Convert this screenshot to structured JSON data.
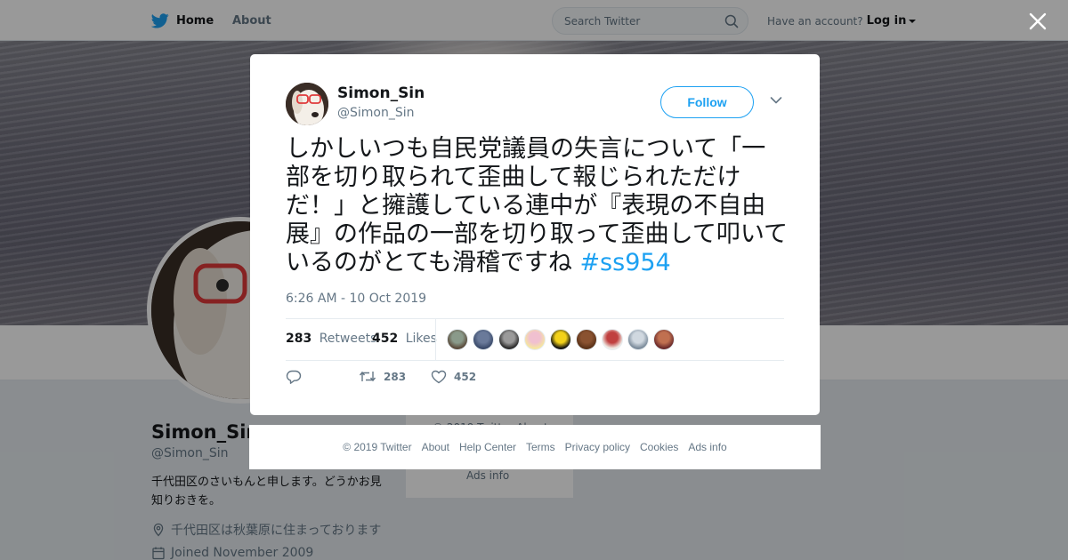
{
  "nav": {
    "home_label": "Home",
    "about_label": "About",
    "search_placeholder": "Search Twitter",
    "account_prompt": "Have an account?",
    "login_label": "Log in"
  },
  "profile": {
    "name": "Simon_Sin",
    "handle": "@Simon_Sin",
    "bio": "千代田区のさいもんと申します。どうかお見知りおきを。",
    "location": "千代田区は秋葉原に住まっております",
    "joined": "Joined November 2009"
  },
  "side_footer": {
    "copyright_partial": "© 2019 Twitter  About",
    "ads_info": "Ads info"
  },
  "tweet": {
    "author_name": "Simon_Sin",
    "author_handle": "@Simon_Sin",
    "follow_label": "Follow",
    "text": "しかしいつも自民党議員の失言について「一部を切り取られて歪曲して報じられただけだ！」と擁護している連中が『表現の不自由展』の作品の一部を切り取って歪曲して叩いているのがとても滑稽ですね ",
    "hashtag": "#ss954",
    "timestamp": "6:26 AM - 10 Oct 2019",
    "retweets_count": "283",
    "retweets_label": "Retweets",
    "likes_count": "452",
    "likes_label": "Likes",
    "action_retweet_count": "283",
    "action_like_count": "452"
  },
  "liker_avatars": [
    {
      "color_a": "#5a4a3a",
      "color_b": "#8a9a8a"
    },
    {
      "color_a": "#3a4a6a",
      "color_b": "#6a7a9a"
    },
    {
      "color_a": "#2a2a2a",
      "color_b": "#9a9a9a"
    },
    {
      "color_a": "#f5e6a0",
      "color_b": "#f0c0d0"
    },
    {
      "color_a": "#111111",
      "color_b": "#f2d21a"
    },
    {
      "color_a": "#5a3218",
      "color_b": "#8a5230"
    },
    {
      "color_a": "#f0ece6",
      "color_b": "#c04040"
    },
    {
      "color_a": "#7a8a9a",
      "color_b": "#d0d8e0"
    },
    {
      "color_a": "#6a2a2a",
      "color_b": "#c07050"
    }
  ],
  "footer": {
    "links": [
      "© 2019 Twitter",
      "About",
      "Help Center",
      "Terms",
      "Privacy policy",
      "Cookies",
      "Ads info"
    ]
  },
  "colors": {
    "accent": "#1da1f2",
    "muted": "#657786",
    "text": "#14171a"
  }
}
